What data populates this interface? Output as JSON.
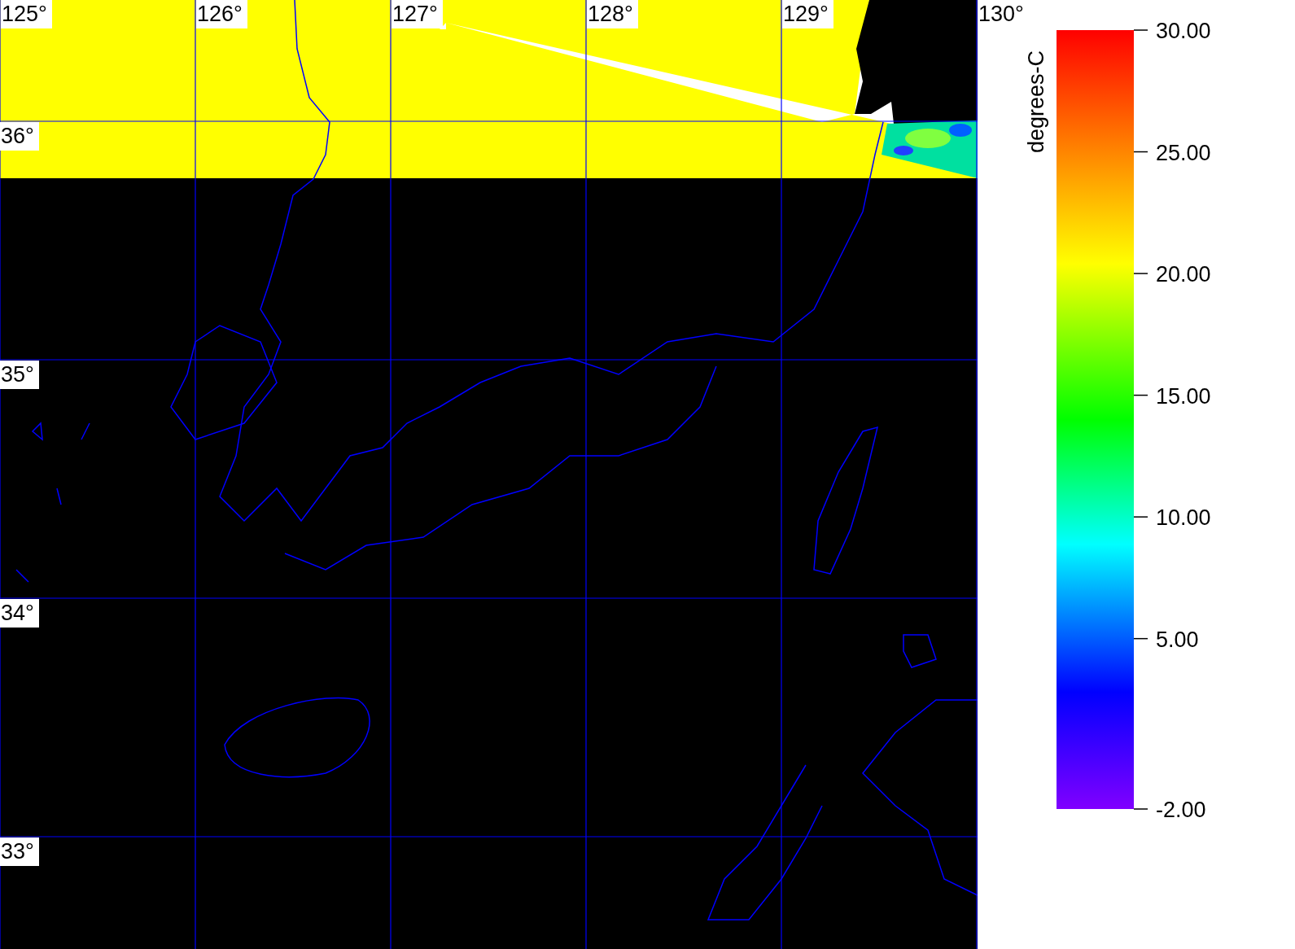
{
  "map": {
    "lon_labels": [
      "125°",
      "126°",
      "127°",
      "128°",
      "129°",
      "130°"
    ],
    "lat_labels": [
      "36°",
      "35°",
      "34°",
      "33°"
    ]
  },
  "colorbar": {
    "title": "degrees-C",
    "ticks": [
      "30.00",
      "25.00",
      "20.00",
      "15.00",
      "10.00",
      "5.00",
      "-2.00"
    ]
  }
}
